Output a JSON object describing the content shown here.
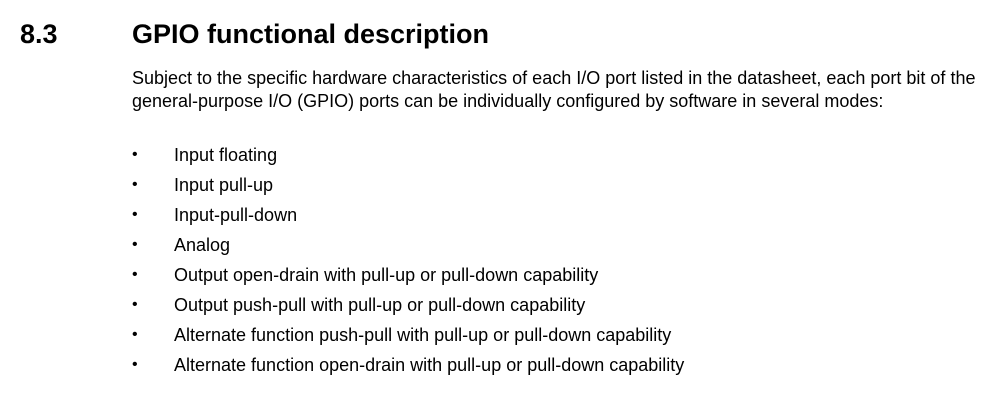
{
  "section": {
    "number": "8.3",
    "title": "GPIO functional description"
  },
  "intro": "Subject to the specific hardware characteristics of each I/O port listed in the datasheet, each port bit of the general-purpose I/O (GPIO) ports can be individually configured by software in several modes:",
  "bullet_symbol": "•",
  "modes": [
    "Input floating",
    "Input pull-up",
    "Input-pull-down",
    "Analog",
    "Output open-drain with pull-up or pull-down capability",
    "Output push-pull with pull-up or pull-down capability",
    "Alternate function push-pull with pull-up or pull-down capability",
    "Alternate function open-drain with pull-up or pull-down capability"
  ]
}
